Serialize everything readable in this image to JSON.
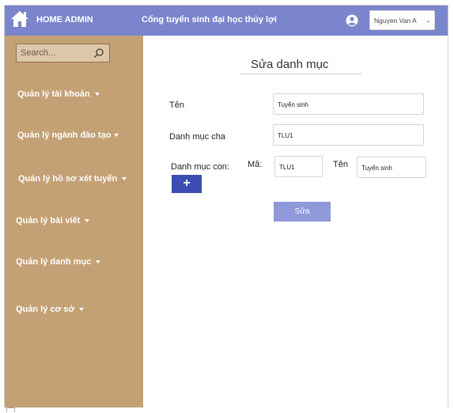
{
  "header": {
    "brand": "HOME ADMIN",
    "site_title": "Cổng tuyển sinh đại học thủy lợi",
    "user_selected": "Nguyen Van A",
    "accent_color": "#7b85cd"
  },
  "sidebar": {
    "search_placeholder": "Search...",
    "background_color": "#c3a175",
    "items": [
      {
        "label": "Quản lý tài khoản"
      },
      {
        "label": "Quản lý ngành đào tạo"
      },
      {
        "label": "Quản lý hồ sơ xét tuyển"
      },
      {
        "label": "Quản lý bài viết"
      },
      {
        "label": "Quản lý danh mục"
      },
      {
        "label": "Quản lý cơ sở"
      }
    ]
  },
  "form": {
    "title": "Sửa danh mục",
    "name_label": "Tên",
    "name_value": "Tuyển sinh",
    "parent_label": "Danh mục cha",
    "parent_value": "TLU1",
    "child_label": "Danh mục con:",
    "code_label": "Mã:",
    "code_value": "TLU1",
    "child_name_label": "Tên",
    "child_name_value": "Tuyển sinh",
    "add_label": "+",
    "save_label": "Sửa"
  },
  "icons": {
    "home": "home-icon",
    "user": "user-circle-icon",
    "search": "search-icon",
    "caret": "caret-down-icon"
  }
}
